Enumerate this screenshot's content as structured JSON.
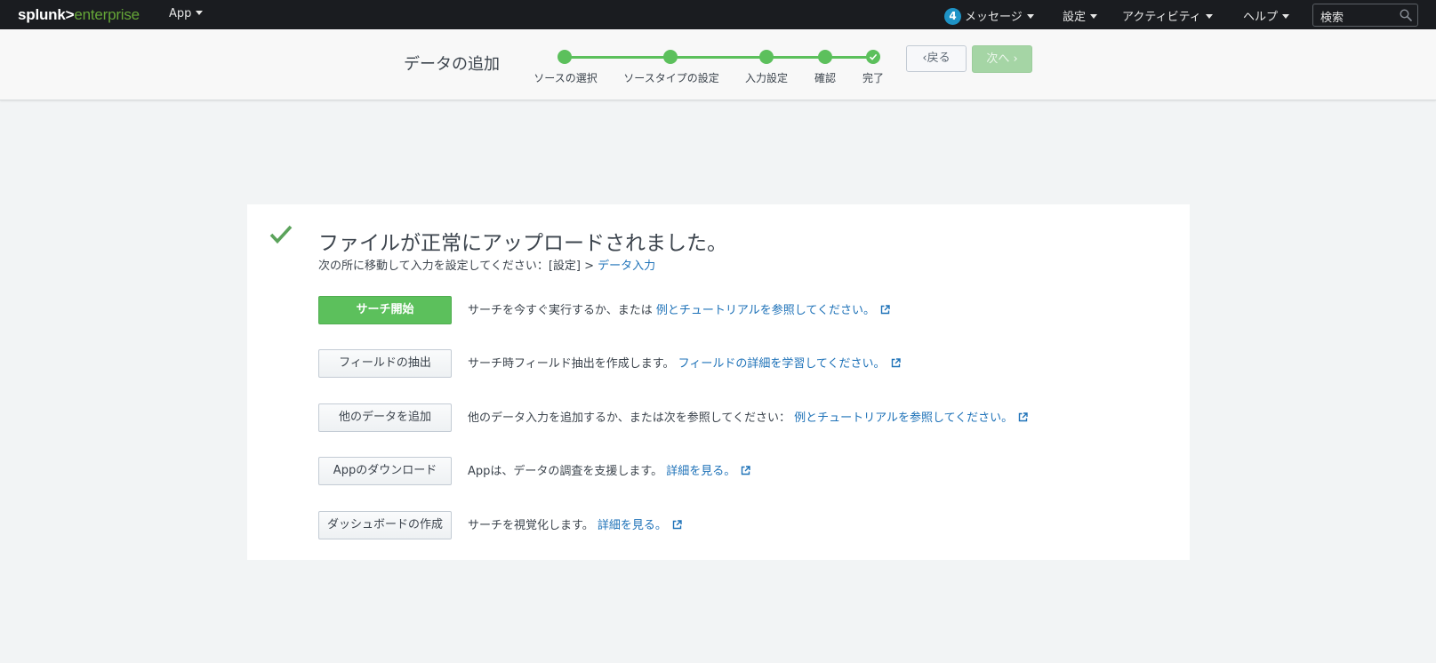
{
  "topbar": {
    "logo_part1": "splunk>",
    "logo_part2": "enterprise",
    "app_menu": "App",
    "messages_count": "4",
    "messages": "メッセージ",
    "settings": "設定",
    "activity": "アクティビティ",
    "help": "ヘルプ",
    "search_placeholder": "検索"
  },
  "wizard": {
    "title": "データの追加",
    "steps": [
      {
        "label": "ソースの選択"
      },
      {
        "label": "ソースタイプの設定"
      },
      {
        "label": "入力設定"
      },
      {
        "label": "確認"
      },
      {
        "label": "完了"
      }
    ],
    "completed_steps": 5,
    "back_label": "戻る",
    "next_label": "次へ"
  },
  "result": {
    "headline": "ファイルが正常にアップロードされました。",
    "subline_prefix": "次の所に移動して入力を設定してください：[設定] > ",
    "subline_link": "データ入力",
    "actions": [
      {
        "button": "サーチ開始",
        "text": "サーチを今すぐ実行するか、または ",
        "link": "例とチュートリアルを参照してください。"
      },
      {
        "button": "フィールドの抽出",
        "text": "サーチ時フィールド抽出を作成します。 ",
        "link": "フィールドの詳細を学習してください。"
      },
      {
        "button": "他のデータを追加",
        "text": "他のデータ入力を追加するか、または次を参照してください： ",
        "link": "例とチュートリアルを参照してください。"
      },
      {
        "button": "Appのダウンロード",
        "text": "Appは、データの調査を支援します。 ",
        "link": "詳細を見る。"
      },
      {
        "button": "ダッシュボードの作成",
        "text": "サーチを視覚化します。 ",
        "link": "詳細を見る。"
      }
    ]
  },
  "colors": {
    "accent_green": "#5cc05c",
    "link_blue": "#1e72b8",
    "topbar_bg": "#1a1c20",
    "badge_blue": "#1e93c6"
  }
}
